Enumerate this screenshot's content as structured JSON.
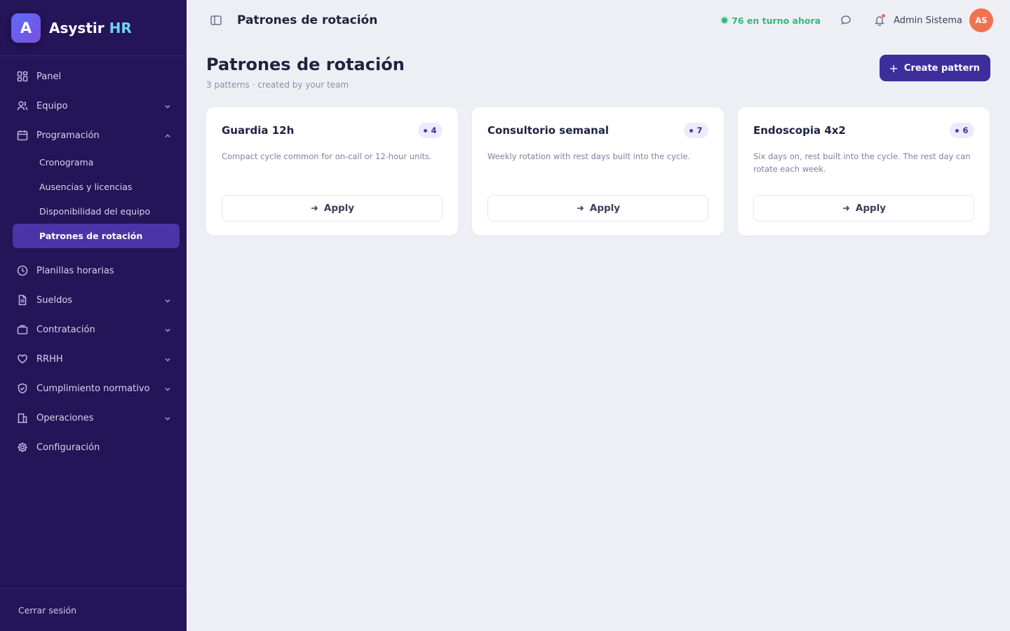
{
  "brand": {
    "logo_letter": "A",
    "name": "Asystir",
    "name_accent": "HR"
  },
  "sidebar": {
    "items": [
      {
        "label": "Panel",
        "icon": "dashboard-icon",
        "expandable": false
      },
      {
        "label": "Equipo",
        "icon": "users-icon",
        "expandable": true
      },
      {
        "label": "Programación",
        "icon": "calendar-icon",
        "expandable": true,
        "expanded": true
      }
    ],
    "sub_items": [
      {
        "label": "Cronograma"
      },
      {
        "label": "Ausencias y licencias"
      },
      {
        "label": "Disponibilidad del equipo"
      },
      {
        "label": "Patrones de rotación",
        "active": true
      }
    ],
    "items_after": [
      {
        "label": "Planillas horarias",
        "icon": "clock-icon",
        "expandable": false
      },
      {
        "label": "Sueldos",
        "icon": "document-icon",
        "expandable": true
      },
      {
        "label": "Contratación",
        "icon": "briefcase-icon",
        "expandable": true
      },
      {
        "label": "RRHH",
        "icon": "heart-icon",
        "expandable": true
      },
      {
        "label": "Cumplimiento normativo",
        "icon": "shield-icon",
        "expandable": true
      },
      {
        "label": "Operaciones",
        "icon": "building-icon",
        "expandable": true
      },
      {
        "label": "Configuración",
        "icon": "gear-icon",
        "expandable": false
      }
    ],
    "logout_label": "Cerrar sesión"
  },
  "topbar": {
    "title": "Patrones de rotación",
    "on_duty": "76 en turno ahora",
    "user_name": "Admin Sistema",
    "avatar_initials": "AS",
    "icons": [
      "sidebar-toggle-icon",
      "chat-icon",
      "bell-icon"
    ]
  },
  "main": {
    "title": "Patrones de rotación",
    "subtitle": "3 patterns · created by your team",
    "create_label": "Create pattern",
    "cards": [
      {
        "title": "Guardia 12h",
        "count": "4",
        "description": "Compact cycle common for on-call or 12-hour units.",
        "apply_label": "Apply"
      },
      {
        "title": "Consultorio semanal",
        "count": "7",
        "description": "Weekly rotation with rest days built into the cycle.",
        "apply_label": "Apply"
      },
      {
        "title": "Endoscopia 4x2",
        "count": "6",
        "description": "Six days on, rest built into the cycle. The rest day can rotate each week.",
        "apply_label": "Apply"
      }
    ]
  },
  "colors": {
    "sidebar_bg": "#241458",
    "active_item": "#4a34a8",
    "primary_button": "#3e2e9b",
    "on_duty_green": "#2fba78",
    "avatar_bg": "#f07250",
    "page_bg": "#eeeff5"
  }
}
